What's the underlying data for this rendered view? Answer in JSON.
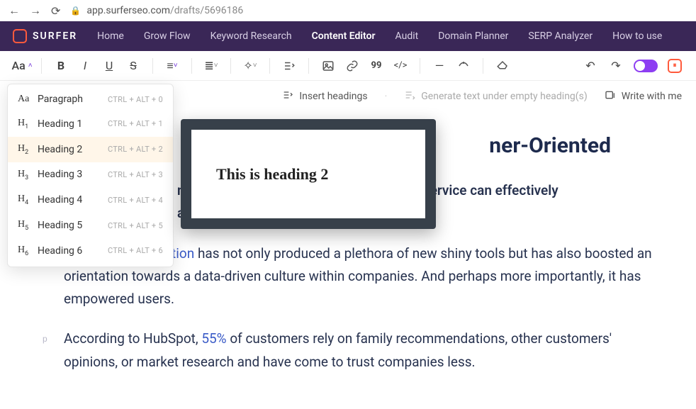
{
  "browser": {
    "url_host": "app.surferseo.com",
    "url_path": "/drafts/5696186"
  },
  "brand": {
    "name": "SURFER"
  },
  "nav": {
    "items": [
      "Home",
      "Grow Flow",
      "Keyword Research",
      "Content Editor",
      "Audit",
      "Domain Planner",
      "SERP Analyzer",
      "How to use"
    ],
    "active_index": 3
  },
  "toolbar": {
    "aa_label": "Aa",
    "quote_label": "99"
  },
  "actionbar": {
    "insert_headings": "Insert headings",
    "generate_text": "Generate text under empty heading(s)",
    "write_with_me": "Write with me"
  },
  "dropdown": {
    "items": [
      {
        "pre": "Aa",
        "label": "Paragraph",
        "shortcut": "CTRL + ALT + 0"
      },
      {
        "pre": "H1",
        "label": "Heading 1",
        "shortcut": "CTRL + ALT + 1"
      },
      {
        "pre": "H2",
        "label": "Heading 2",
        "shortcut": "CTRL + ALT + 2"
      },
      {
        "pre": "H3",
        "label": "Heading 3",
        "shortcut": "CTRL + ALT + 3"
      },
      {
        "pre": "H4",
        "label": "Heading 4",
        "shortcut": "CTRL + ALT + 4"
      },
      {
        "pre": "H5",
        "label": "Heading 5",
        "shortcut": "CTRL + ALT + 5"
      },
      {
        "pre": "H6",
        "label": "Heading 6",
        "shortcut": "CTRL + ALT + 6"
      }
    ],
    "hover_index": 2
  },
  "preview": {
    "text": "This is heading 2"
  },
  "document": {
    "heading_visible_right": "ner-Oriented",
    "para1_a": "n",
    "para1_b": "r service can effectively ",
    "para1_c": "and pain of customers and buyers.",
    "para2_link": "Digital transformation",
    "para2_rest": " has not only produced a plethora of new shiny tools but has also boosted an orientation towards a data-driven culture within companies. And perhaps more importantly, it has empowered users.",
    "para3_a": "According to HubSpot, ",
    "para3_link": "55%",
    "para3_b": " of customers rely on family recommendations, other customers' opinions, or market research and have come to trust companies less."
  }
}
